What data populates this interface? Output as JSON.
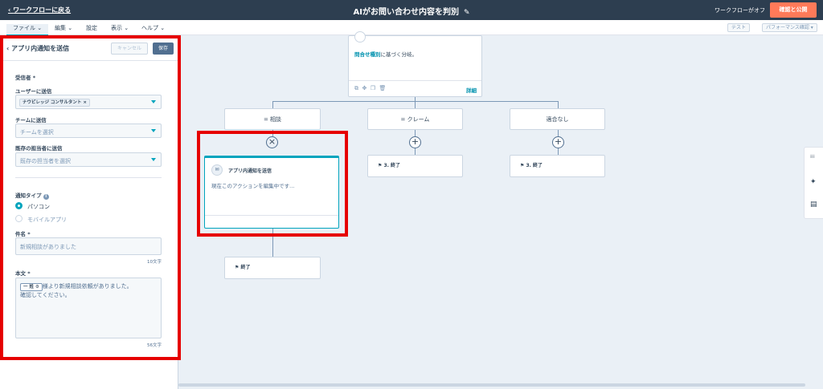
{
  "topbar": {
    "back_link": "ワークフローに戻る",
    "title": "AIがお問い合わせ内容を判別",
    "status": "ワークフローがオフ",
    "publish_button": "確認と公開",
    "back_icon": "chevron-left-icon",
    "edit_icon": "pencil-icon"
  },
  "menubar": {
    "items": [
      "ファイル",
      "編集",
      "設定",
      "表示",
      "ヘルプ"
    ],
    "test_button": "テスト",
    "performance_button": "パフォーマンス確認"
  },
  "panel": {
    "title": "アプリ内通知を送信",
    "cancel_button": "キャンセル",
    "save_button": "保存",
    "recipients_label": "受信者 *",
    "send_to_users_label": "ユーザーに送信",
    "user_tag": "ナウビレッジ コンサルタント",
    "send_to_team_label": "チームに送信",
    "team_placeholder": "チームを選択",
    "send_to_owner_label": "既存の担当者に送信",
    "owner_placeholder": "既存の担当者を選択",
    "notification_type_label": "通知タイプ",
    "option_desktop": "パソコン",
    "option_mobile": "モバイルアプリ",
    "subject_label": "件名 *",
    "subject_value": "新規相談がありました",
    "subject_counter": "10文字",
    "body_label": "本文 *",
    "body_token": "一 姓",
    "body_line1": "様より新規相談依頼がありました。",
    "body_line2": "確認してください。",
    "body_counter": "56文字"
  },
  "canvas": {
    "top_node_text_link": "問合せ種別",
    "top_node_text_rest": "に基づく分岐。",
    "top_node_details": "詳細",
    "branches": [
      "= 相談",
      "= クレーム",
      "適合なし"
    ],
    "action_node_title": "アプリ内通知を送信",
    "action_node_status": "現在このアクションを編集中です...",
    "end_nodes": [
      "3. 終了",
      "3. 終了",
      "終了"
    ]
  },
  "colors": {
    "topbar_bg": "#2d3e50",
    "accent": "#00a4bd",
    "publish": "#ff7a59",
    "highlight": "#e60000"
  }
}
